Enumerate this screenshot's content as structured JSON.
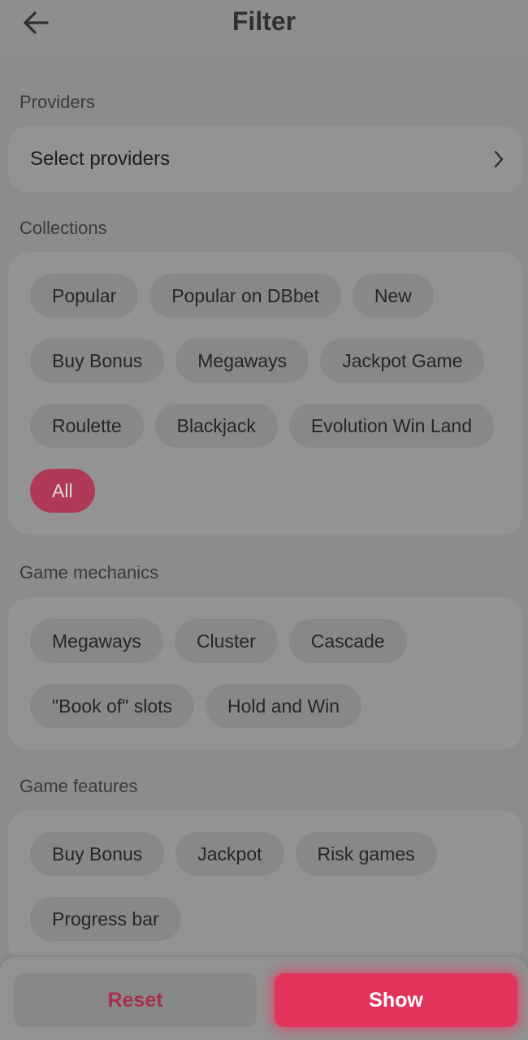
{
  "header": {
    "title": "Filter",
    "back_icon": "arrow-left-icon"
  },
  "providers": {
    "label": "Providers",
    "select_label": "Select providers",
    "chevron_icon": "chevron-right-icon"
  },
  "collections": {
    "label": "Collections",
    "chips": [
      "Popular",
      "Popular on DBbet",
      "New",
      "Buy Bonus",
      "Megaways",
      "Jackpot Game",
      "Roulette",
      "Blackjack",
      "Evolution Win Land",
      "All"
    ],
    "active": "All"
  },
  "mechanics": {
    "label": "Game mechanics",
    "chips": [
      "Megaways",
      "Cluster",
      "Cascade",
      "\"Book of\" slots",
      "Hold and Win"
    ]
  },
  "features": {
    "label": "Game features",
    "chips": [
      "Buy Bonus",
      "Jackpot",
      "Risk games",
      "Progress bar"
    ]
  },
  "footer": {
    "reset_label": "Reset",
    "show_label": "Show"
  },
  "colors": {
    "accent": "#e2345b",
    "active_chip": "#b03a56"
  }
}
